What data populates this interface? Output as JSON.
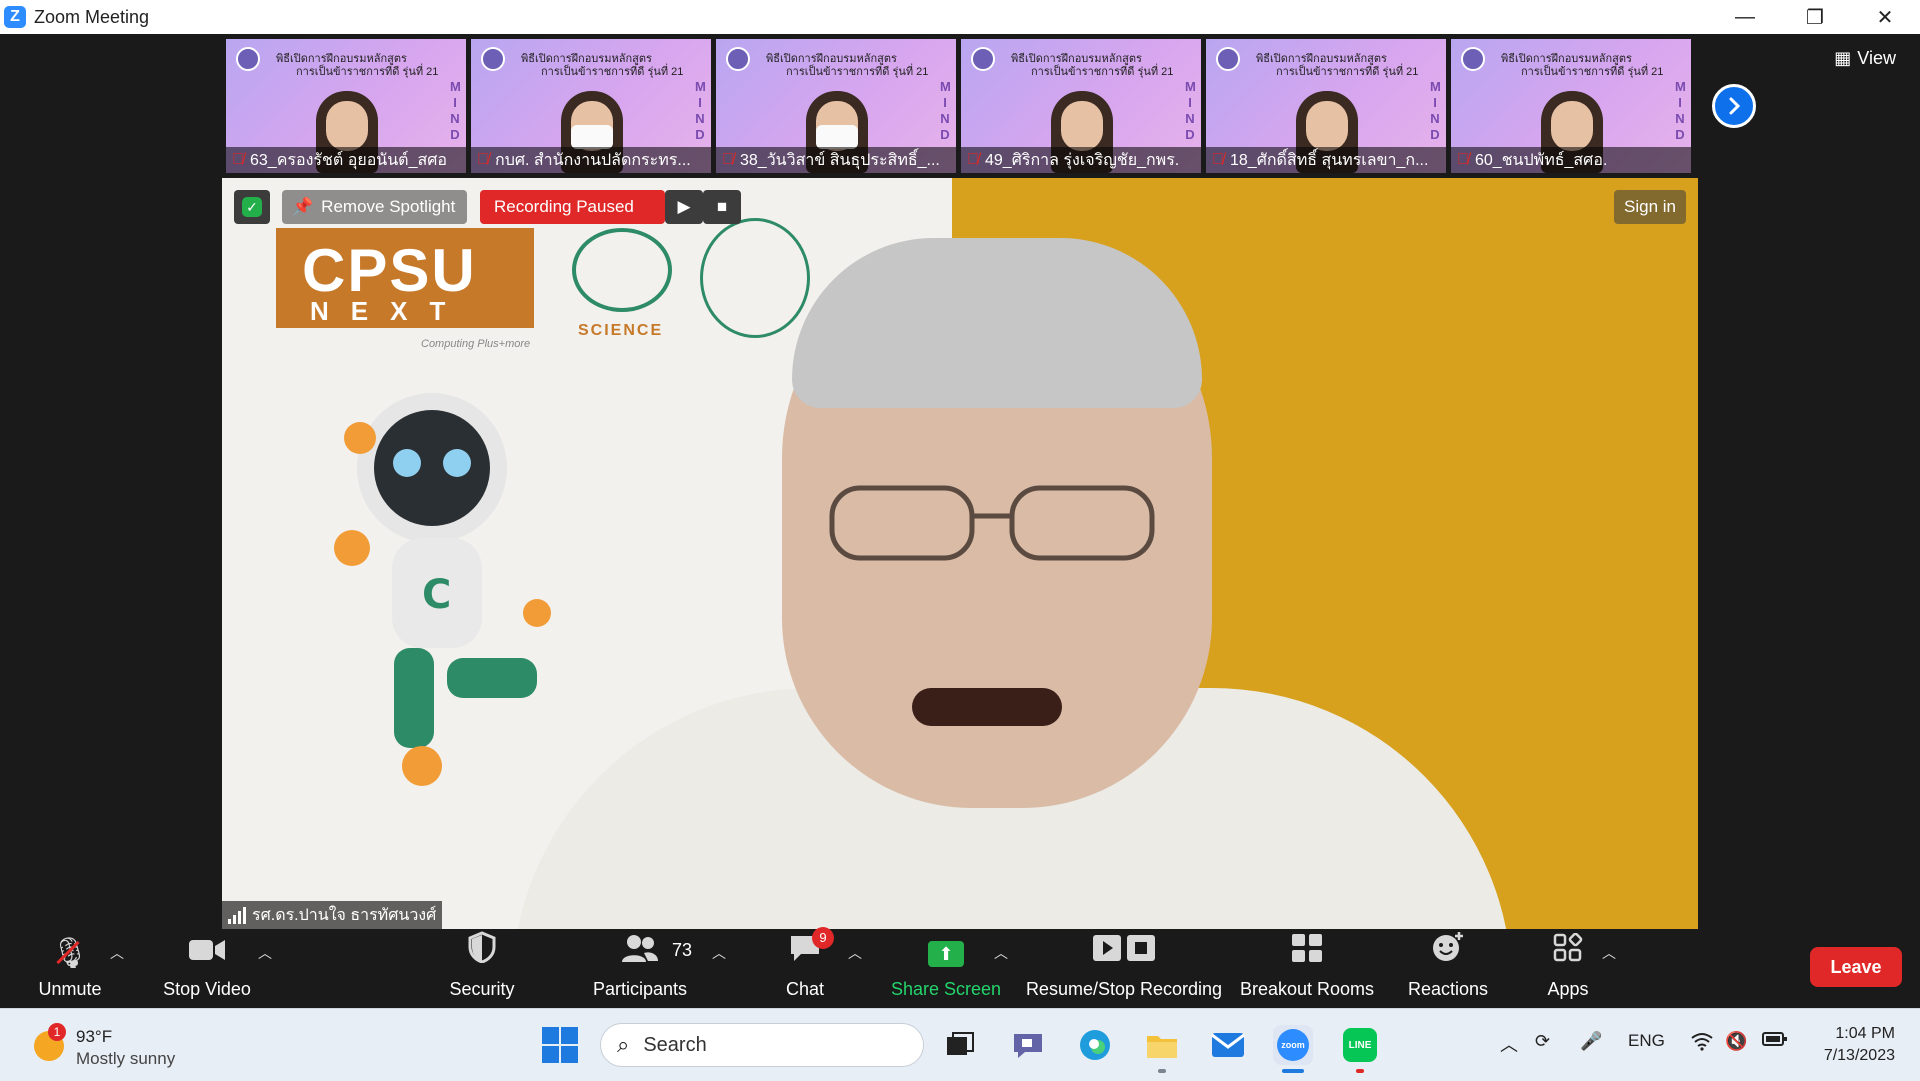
{
  "window": {
    "title": "Zoom Meeting",
    "controls": {
      "minimize": "—",
      "restore": "❐",
      "close": "✕"
    }
  },
  "top": {
    "view_label": "View",
    "thumbnails": [
      {
        "header1": "พิธีเปิดการฝึกอบรมหลักสูตร",
        "header2": "การเป็นข้าราชการที่ดี รุ่นที่ 21",
        "name": "63_ครองรัชต์ อุยอนันต์_สศอ",
        "mask": false
      },
      {
        "header1": "พิธีเปิดการฝึกอบรมหลักสูตร",
        "header2": "การเป็นข้าราชการที่ดี รุ่นที่ 21",
        "name": "กบศ. สำนักงานปลัดกระทร...",
        "mask": true
      },
      {
        "header1": "พิธีเปิดการฝึกอบรมหลักสูตร",
        "header2": "การเป็นข้าราชการที่ดี รุ่นที่ 21",
        "name": "38_วันวิสาข์ สินธุประสิทธิ์_...",
        "mask": true
      },
      {
        "header1": "พิธีเปิดการฝึกอบรมหลักสูตร",
        "header2": "การเป็นข้าราชการที่ดี รุ่นที่ 21",
        "name": "49_ศิริกาล รุ่งเจริญชัย_กพร.",
        "mask": false
      },
      {
        "header1": "พิธีเปิดการฝึกอบรมหลักสูตร",
        "header2": "การเป็นข้าราชการที่ดี รุ่นที่ 21",
        "name": "18_ศักดิ์สิทธิ์ สุนทรเลขา_ก...",
        "mask": false
      },
      {
        "header1": "พิธีเปิดการฝึกอบรมหลักสูตร",
        "header2": "การเป็นข้าราชการที่ดี รุ่นที่ 21",
        "name": "60_ชนปพัทธ์_สศอ.",
        "mask": false
      }
    ],
    "mind_letters": [
      "M",
      "I",
      "N",
      "D"
    ]
  },
  "main": {
    "remove_spotlight": "Remove Spotlight",
    "recording_status": "Recording Paused",
    "sign_in": "Sign in",
    "speaker_name": "รศ.ดร.ปานใจ ธารทัศนวงศ์",
    "cpsu_text": "CPSU",
    "next_text": "NEXT",
    "cpsu_sub": "Computing Plus+more",
    "science_text": "SCIENCE"
  },
  "toolbar": {
    "unmute": "Unmute",
    "stop_video": "Stop Video",
    "security": "Security",
    "participants": "Participants",
    "participants_count": "73",
    "chat": "Chat",
    "chat_badge": "9",
    "share_screen": "Share Screen",
    "recording": "Resume/Stop Recording",
    "breakout": "Breakout Rooms",
    "reactions": "Reactions",
    "apps": "Apps",
    "leave": "Leave"
  },
  "taskbar": {
    "weather_badge": "1",
    "temperature": "93°F",
    "weather_desc": "Mostly sunny",
    "search_placeholder": "Search",
    "lang": "ENG",
    "time": "1:04 PM",
    "date": "7/13/2023"
  },
  "colors": {
    "accent_blue": "#0e71eb",
    "record_red": "#e02828",
    "share_green": "#23d46b",
    "background_gold": "#d7a11e"
  }
}
